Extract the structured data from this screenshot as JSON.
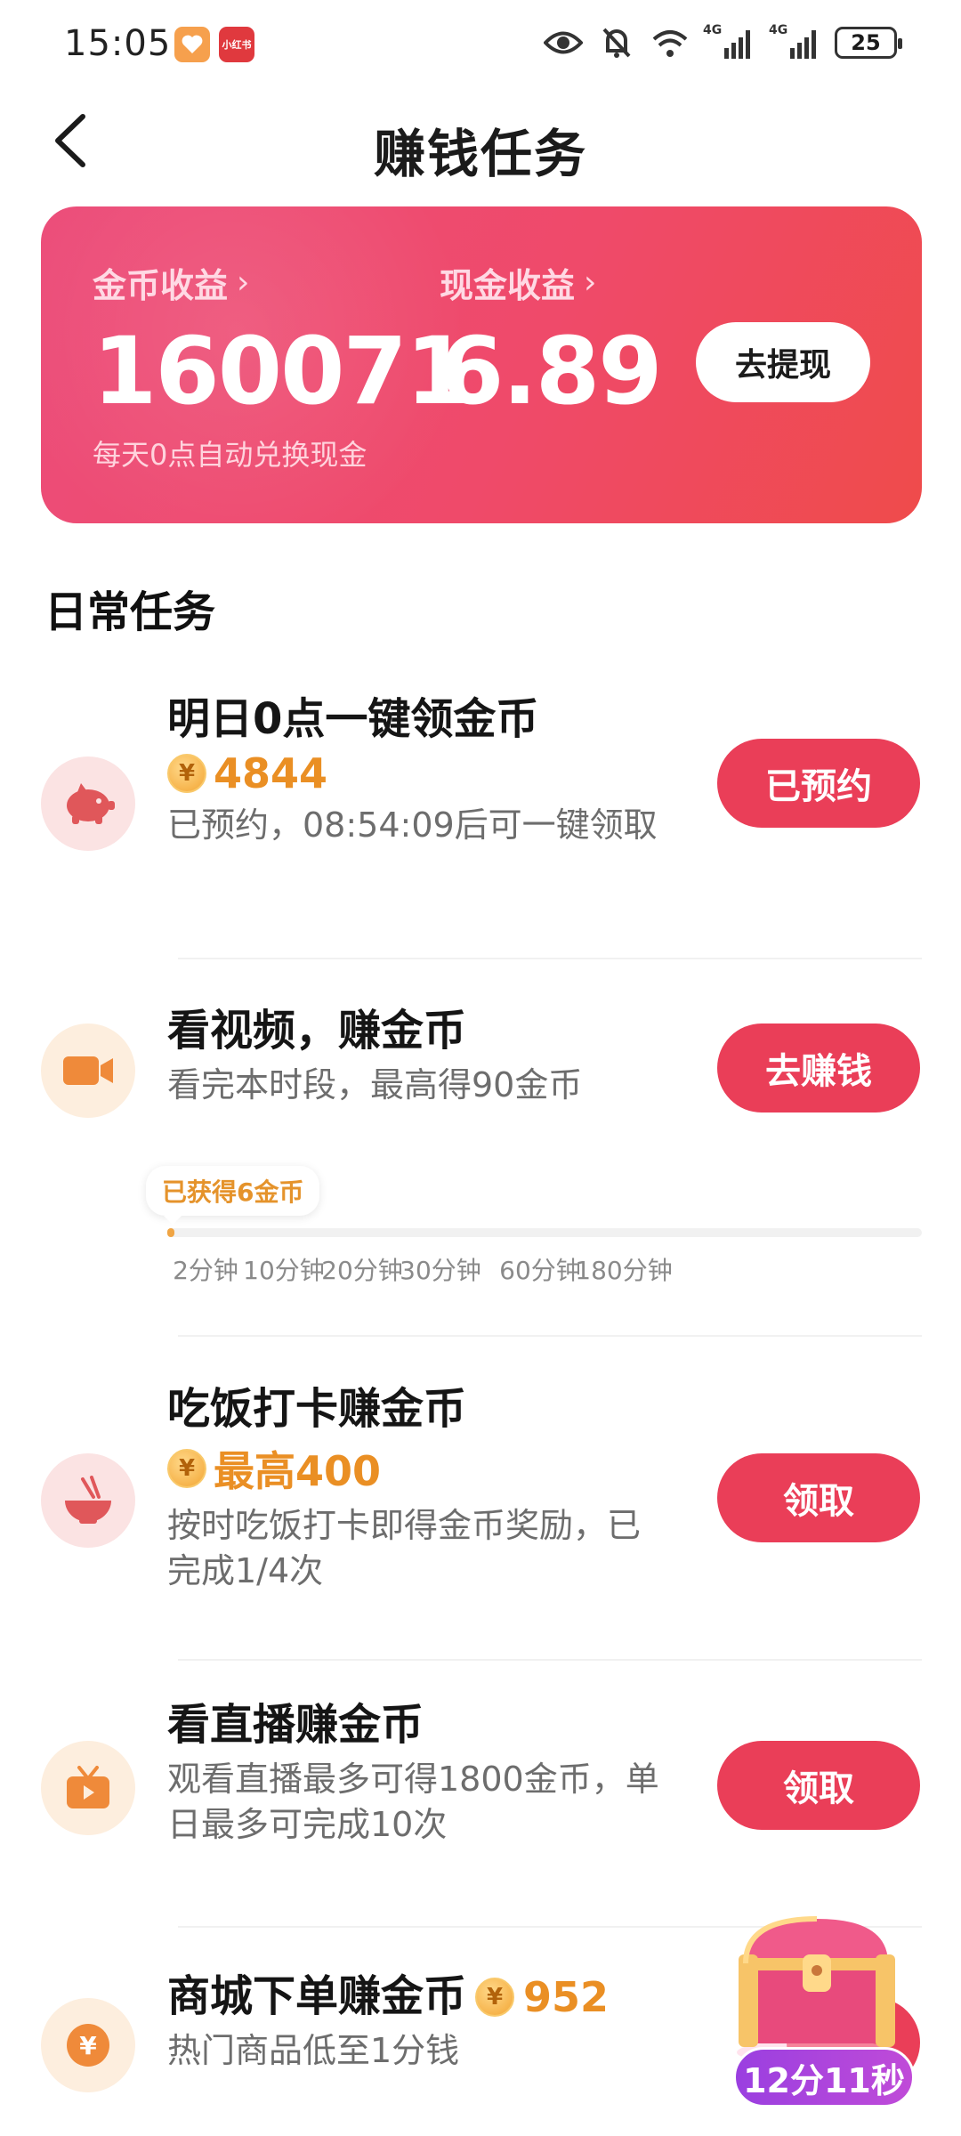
{
  "status_bar": {
    "time": "15:05",
    "app_icon_2_text": "小红书",
    "network_1": "4G",
    "network_2": "4G",
    "battery": "25"
  },
  "header": {
    "title": "赚钱任务"
  },
  "earnings": {
    "coin_label": "金币收益",
    "coin_value": "160071",
    "cash_label": "现金收益",
    "cash_value": "6.89",
    "note": "每天0点自动兑换现金",
    "withdraw_label": "去提现"
  },
  "section_title": "日常任务",
  "tasks": [
    {
      "title": "明日0点一键领金币",
      "reward": "4844",
      "desc": "已预约，08:54:09后可一键领取",
      "button": "已预约",
      "icon": "piggy-bank-icon"
    },
    {
      "title": "看视频，赚金币",
      "desc": "看完本时段，最高得90金币",
      "button": "去赚钱",
      "icon": "video-camera-icon"
    },
    {
      "title": "吃饭打卡赚金币",
      "reward": "最高400",
      "desc": "按时吃饭打卡即得金币奖励，已完成1/4次",
      "button": "领取",
      "icon": "rice-bowl-icon"
    },
    {
      "title": "看直播赚金币",
      "desc": "观看直播最多可得1800金币，单日最多可完成10次",
      "button": "领取",
      "icon": "tv-icon"
    },
    {
      "title": "商城下单赚金币",
      "reward": "952",
      "desc": "热门商品低至1分钱",
      "icon": "yuan-icon"
    }
  ],
  "video_progress": {
    "earned_label": "已获得6金币",
    "progress_fraction": 0.01,
    "ticks": [
      "2分钟",
      "10分钟",
      "20分钟",
      "30分钟",
      "60分钟",
      "180分钟"
    ]
  },
  "chest": {
    "timer": "12分11秒",
    "icon": "treasure-chest-icon"
  },
  "colors": {
    "accent": "#ea3e58",
    "coin_orange": "#ea8f24",
    "card_gradient_start": "#ec4d7a",
    "card_gradient_end": "#ef4b4b"
  }
}
